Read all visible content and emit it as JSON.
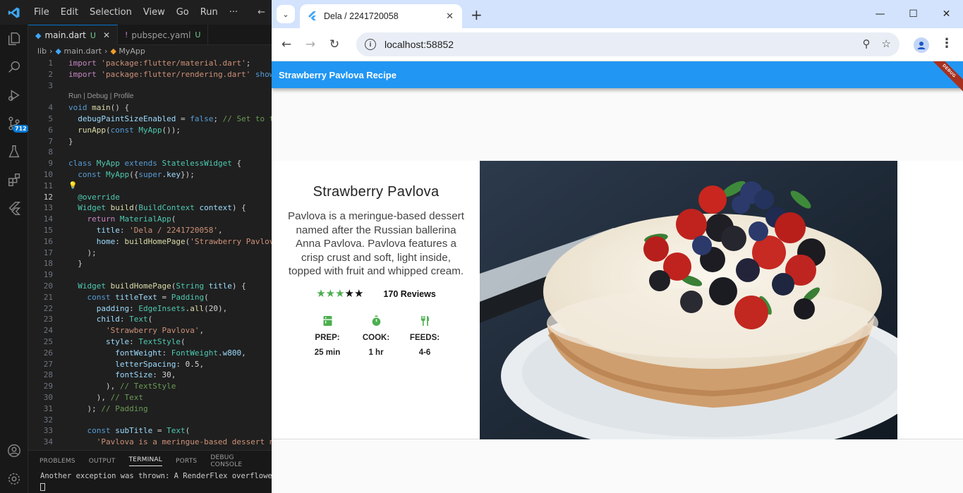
{
  "vscode": {
    "menu": [
      "File",
      "Edit",
      "Selection",
      "View",
      "Go",
      "Run",
      "···"
    ],
    "badge_count": "712",
    "tabs": [
      {
        "label": "main.dart",
        "status": "U",
        "icon": "dart-icon"
      },
      {
        "label": "pubspec.yaml",
        "status": "U",
        "icon": "yaml-icon"
      }
    ],
    "breadcrumb": [
      "lib",
      "main.dart",
      "MyApp"
    ],
    "code_lens": "Run | Debug | Profile",
    "current_line": 12,
    "code_lines": [
      {
        "n": "1",
        "html": "<span class='c'>import</span> <span class='s'>'package:flutter/material.dart'</span>;"
      },
      {
        "n": "2",
        "html": "<span class='c'>import</span> <span class='s'>'package:flutter/rendering.dart'</span> <span class='k'>show</span>"
      },
      {
        "n": "3",
        "html": ""
      },
      {
        "n": "4",
        "html": "<span class='k'>void</span> <span class='f'>main</span>() {"
      },
      {
        "n": "5",
        "html": "  <span class='v'>debugPaintSizeEnabled</span> = <span class='k'>false</span>; <span class='cm'>// Set to tr</span>"
      },
      {
        "n": "6",
        "html": "  <span class='f'>runApp</span>(<span class='k'>const</span> <span class='t'>MyApp</span>());"
      },
      {
        "n": "7",
        "html": "}"
      },
      {
        "n": "8",
        "html": ""
      },
      {
        "n": "9",
        "html": "<span class='k'>class</span> <span class='t'>MyApp</span> <span class='k'>extends</span> <span class='t'>StatelessWidget</span> {"
      },
      {
        "n": "10",
        "html": "  <span class='k'>const</span> <span class='t'>MyApp</span>({<span class='k'>super</span>.<span class='v'>key</span>});"
      },
      {
        "n": "11",
        "html": ""
      },
      {
        "n": "12",
        "html": "  <span class='t'>@override</span>"
      },
      {
        "n": "13",
        "html": "  <span class='t'>Widget</span> <span class='f'>build</span>(<span class='t'>BuildContext</span> <span class='v'>context</span>) {"
      },
      {
        "n": "14",
        "html": "    <span class='c'>return</span> <span class='t'>MaterialApp</span>("
      },
      {
        "n": "15",
        "html": "      <span class='v'>title</span>: <span class='s'>'Dela / 2241720058'</span>,"
      },
      {
        "n": "16",
        "html": "      <span class='v'>home</span>: <span class='f'>buildHomePage</span>(<span class='s'>'Strawberry Pavlov</span>"
      },
      {
        "n": "17",
        "html": "    );"
      },
      {
        "n": "18",
        "html": "  }"
      },
      {
        "n": "19",
        "html": ""
      },
      {
        "n": "20",
        "html": "  <span class='t'>Widget</span> <span class='f'>buildHomePage</span>(<span class='t'>String</span> <span class='v'>title</span>) {"
      },
      {
        "n": "21",
        "html": "    <span class='k'>const</span> <span class='v'>titleText</span> = <span class='t'>Padding</span>("
      },
      {
        "n": "22",
        "html": "      <span class='v'>padding</span>: <span class='t'>EdgeInsets</span>.<span class='f'>all</span>(<span class='p'>20</span>),"
      },
      {
        "n": "23",
        "html": "      <span class='v'>child</span>: <span class='t'>Text</span>("
      },
      {
        "n": "24",
        "html": "        <span class='s'>'Strawberry Pavlova'</span>,"
      },
      {
        "n": "25",
        "html": "        <span class='v'>style</span>: <span class='t'>TextStyle</span>("
      },
      {
        "n": "26",
        "html": "          <span class='v'>fontWeight</span>: <span class='t'>FontWeight</span>.<span class='v'>w800</span>,"
      },
      {
        "n": "27",
        "html": "          <span class='v'>letterSpacing</span>: <span class='p'>0.5</span>,"
      },
      {
        "n": "28",
        "html": "          <span class='v'>fontSize</span>: <span class='p'>30</span>,"
      },
      {
        "n": "29",
        "html": "        ), <span class='cm'>// TextStyle</span>"
      },
      {
        "n": "30",
        "html": "      ), <span class='cm'>// Text</span>"
      },
      {
        "n": "31",
        "html": "    ); <span class='cm'>// Padding</span>"
      },
      {
        "n": "32",
        "html": ""
      },
      {
        "n": "33",
        "html": "    <span class='k'>const</span> <span class='v'>subTitle</span> = <span class='t'>Text</span>("
      },
      {
        "n": "34",
        "html": "      <span class='s'>'Pavlova is a meringue-based dessert na</span>"
      }
    ],
    "panel_tabs": [
      "PROBLEMS",
      "OUTPUT",
      "TERMINAL",
      "PORTS",
      "DEBUG CONSOLE"
    ],
    "panel_active": "TERMINAL",
    "terminal_line": "Another exception was thrown: A RenderFlex overflowed b"
  },
  "browser": {
    "tab_title": "Dela / 2241720058",
    "url": "localhost:58852",
    "icons": [
      "back-icon",
      "forward-icon",
      "reload-icon",
      "zoom-icon",
      "bookmark-star-icon",
      "profile-icon",
      "menu-icon"
    ]
  },
  "app": {
    "appbar_title": "Strawberry Pavlova Recipe",
    "debug_banner": "DEBUG",
    "title": "Strawberry Pavlova",
    "subtitle": "Pavlova is a meringue-based dessert named after the Russian ballerina Anna Pavlova. Pavlova features a crisp crust and soft, light inside, topped with fruit and whipped cream.",
    "rating": {
      "filled": 3,
      "total": 5
    },
    "reviews": "170 Reviews",
    "info": [
      {
        "label": "PREP:",
        "value": "25 min",
        "icon": "kitchen-icon"
      },
      {
        "label": "COOK:",
        "value": "1 hr",
        "icon": "timer-icon"
      },
      {
        "label": "FEEDS:",
        "value": "4-6",
        "icon": "restaurant-icon"
      }
    ],
    "colors": {
      "appbar": "#2196f3",
      "star_on": "#4caf50",
      "star_off": "#111111",
      "info_icon": "#4caf50"
    }
  }
}
